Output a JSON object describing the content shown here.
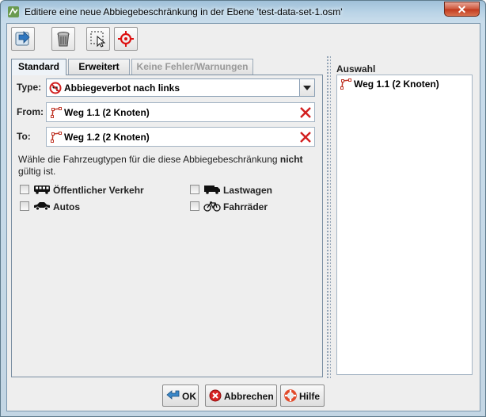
{
  "window": {
    "title": "Editiere eine neue Abbiegebeschränkung in der Ebene 'test-data-set-1.osm'",
    "close_label": "✕"
  },
  "toolbar": {
    "buttons": [
      {
        "name": "apply-icon"
      },
      {
        "name": "delete-icon"
      },
      {
        "name": "select-icon"
      },
      {
        "name": "zoom-to-icon"
      }
    ]
  },
  "tabs": [
    {
      "label": "Standard"
    },
    {
      "label": "Erweitert"
    },
    {
      "label": "Keine Fehler/Warnungen"
    }
  ],
  "form": {
    "type_label": "Type:",
    "type_value": "Abbiegeverbot nach links",
    "from_label": "From:",
    "from_value": "Weg 1.1 (2 Knoten)",
    "to_label": "To:",
    "to_value": "Weg 1.2 (2 Knoten)",
    "hint_part1": "Wähle die Fahrzeugtypen für die diese Abbiegebeschränkung ",
    "hint_bold": "nicht",
    "hint_part2": " gültig ist.",
    "vehicles": [
      {
        "label": "Öffentlicher Verkehr",
        "icon": "bus-icon",
        "checked": false
      },
      {
        "label": "Lastwagen",
        "icon": "truck-icon",
        "checked": false
      },
      {
        "label": "Autos",
        "icon": "car-icon",
        "checked": false
      },
      {
        "label": "Fahrräder",
        "icon": "bicycle-icon",
        "checked": false
      }
    ]
  },
  "selection": {
    "title": "Auswahl",
    "items": [
      {
        "label": "Weg 1.1 (2 Knoten)"
      }
    ]
  },
  "buttons": {
    "ok": "OK",
    "cancel": "Abbrechen",
    "help": "Hilfe"
  },
  "colors": {
    "accent": "#7a8ea2",
    "delete_red": "#d21f1f",
    "way_icon": "#c0392b"
  }
}
